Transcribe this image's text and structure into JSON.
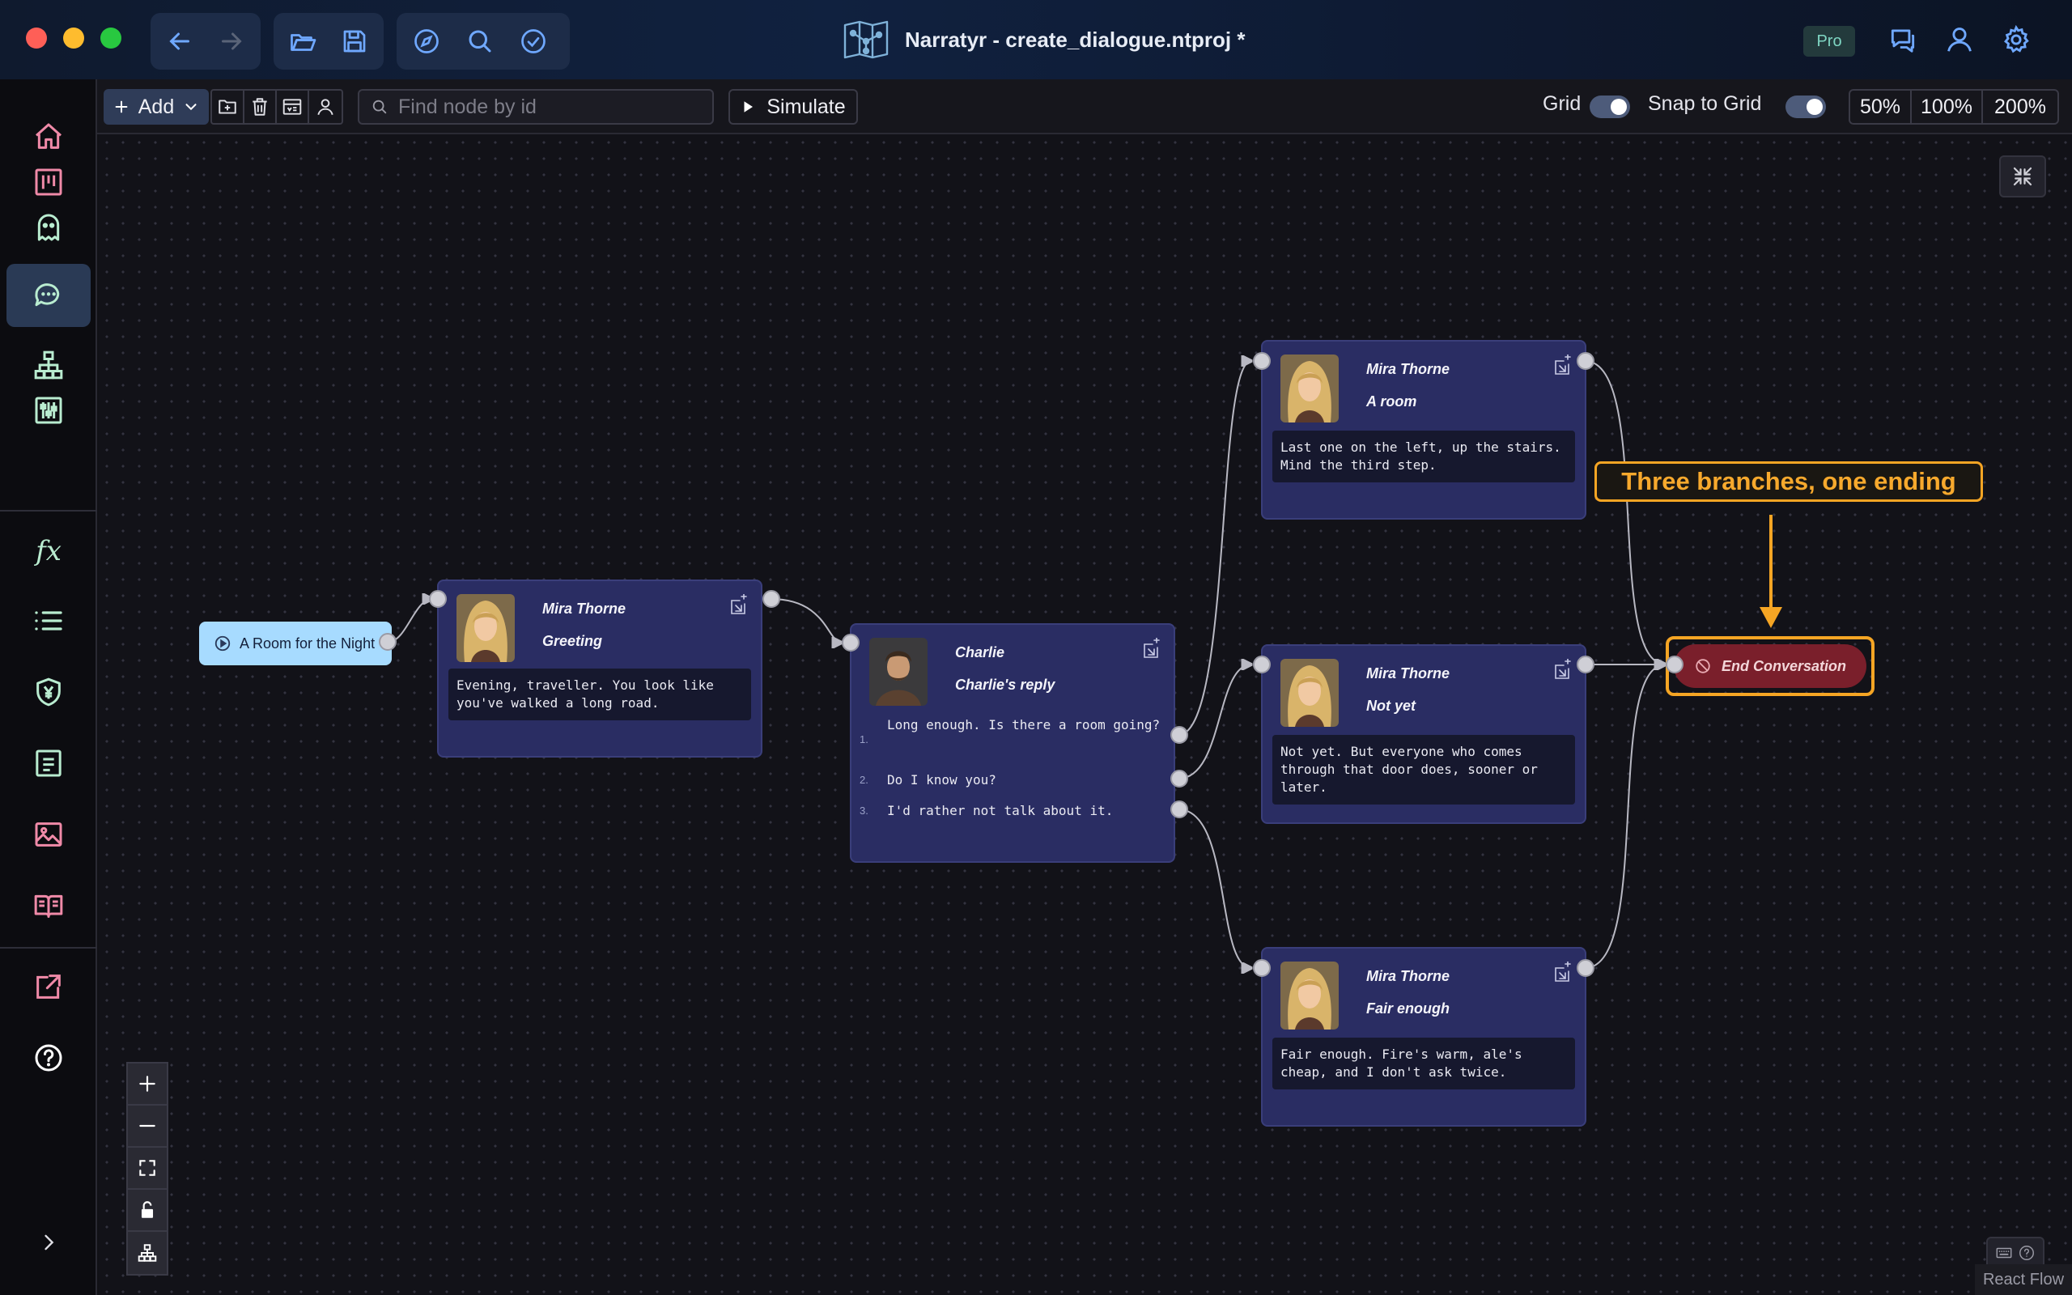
{
  "window": {
    "title": "Narratyr - create_dialogue.ntproj *",
    "badge": "Pro"
  },
  "titlebar_icons": {
    "left": [
      "back-arrow-icon",
      "forward-arrow-icon",
      "folder-open-icon",
      "save-icon",
      "compass-icon",
      "search-icon",
      "check-circle-icon"
    ],
    "right": [
      "chat-bubbles-icon",
      "user-icon",
      "gear-icon"
    ]
  },
  "sidebar": {
    "items": [
      {
        "icon": "home-icon"
      },
      {
        "icon": "kanban-icon"
      },
      {
        "icon": "ghost-icon"
      },
      {
        "icon": "dialogue-icon",
        "active": true
      },
      {
        "icon": "hierarchy-icon"
      },
      {
        "icon": "sliders-icon"
      },
      {
        "icon": "function-icon",
        "label": "fx"
      },
      {
        "icon": "list-icon"
      },
      {
        "icon": "currency-shield-icon"
      },
      {
        "icon": "document-icon"
      },
      {
        "icon": "image-icon"
      },
      {
        "icon": "book-icon"
      },
      {
        "icon": "export-icon"
      },
      {
        "icon": "help-icon"
      }
    ],
    "expand_icon": "chevron-right-icon"
  },
  "toolbar": {
    "add_label": "Add",
    "search_placeholder": "Find node by id",
    "simulate_label": "Simulate",
    "grid_label": "Grid",
    "grid_on": true,
    "snap_label": "Snap to Grid",
    "snap_on": true,
    "zoom_levels": [
      "50%",
      "100%",
      "200%"
    ]
  },
  "graph": {
    "start": {
      "label": "A Room for the Night"
    },
    "greeting": {
      "speaker": "Mira Thorne",
      "title": "Greeting",
      "text": "Evening, traveller. You look like you've walked a long road."
    },
    "reply": {
      "speaker": "Charlie",
      "title": "Charlie's reply",
      "choices": [
        {
          "num": "1.",
          "text": "Long enough. Is there a room going?"
        },
        {
          "num": "2.",
          "text": "Do I know you?"
        },
        {
          "num": "3.",
          "text": "I'd rather not talk about it."
        }
      ]
    },
    "a_room": {
      "speaker": "Mira Thorne",
      "title": "A room",
      "text": "Last one on the left, up the stairs. Mind the third step."
    },
    "not_yet": {
      "speaker": "Mira Thorne",
      "title": "Not yet",
      "text": "Not yet. But everyone who comes through that door does, sooner or later."
    },
    "fair_enough": {
      "speaker": "Mira Thorne",
      "title": "Fair enough",
      "text": "Fair enough. Fire's warm, ale's cheap, and I don't ask twice."
    },
    "end": {
      "label": "End Conversation"
    }
  },
  "annotation": {
    "text": "Three branches, one ending",
    "color": "#f5a524"
  },
  "canvas_controls": [
    "zoom-in-icon",
    "zoom-out-icon",
    "fit-view-icon",
    "lock-icon",
    "layout-icon"
  ],
  "attribution": "React Flow",
  "colors": {
    "node_bg": "#2a2d63",
    "start_bg": "#a7dbff",
    "end_bg": "#7a1f2b",
    "accent": "#f5a524"
  }
}
